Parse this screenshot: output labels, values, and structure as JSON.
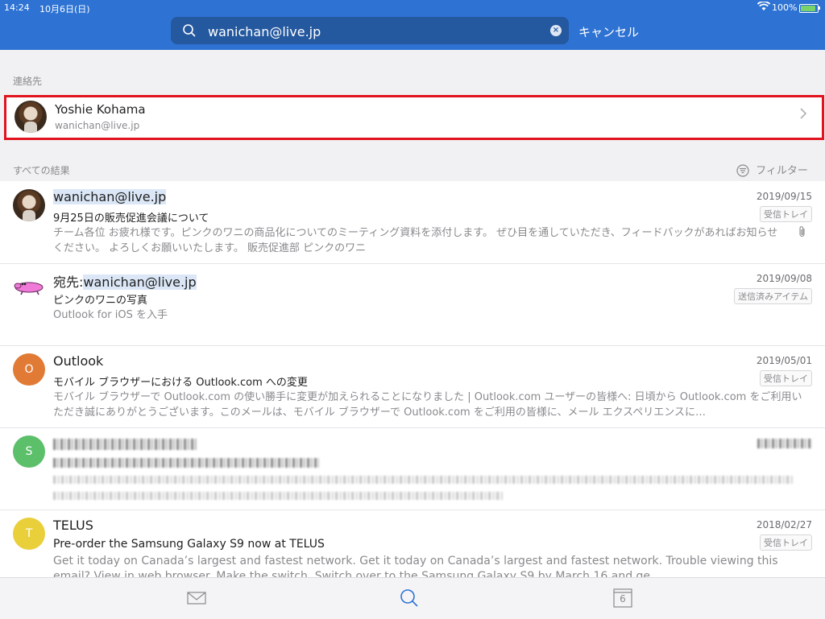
{
  "status_bar": {
    "time": "14:24",
    "date": "10月6日(日)",
    "battery": "100%"
  },
  "search": {
    "query": "wanichan@live.jp",
    "cancel_label": "キャンセル"
  },
  "contacts_section": {
    "label": "連絡先",
    "contact": {
      "name": "Yoshie Kohama",
      "email": "wanichan@live.jp"
    }
  },
  "results_section": {
    "label": "すべての結果",
    "filter_label": "フィルター"
  },
  "messages": [
    {
      "sender": "wanichan@live.jp",
      "subject": "9月25日の販売促進会議について",
      "preview": "チーム各位 お疲れ様です。ピンクのワニの商品化についてのミーティング資料を添付します。 ぜひ目を通していただき、フィードバックがあればお知らせください。 よろしくお願いいたします。 販売促進部 ピンクのワニ",
      "date": "2019/09/15",
      "folder": "受信トレイ",
      "has_attachment": true
    },
    {
      "sender_prefix": "宛先:",
      "sender": "wanichan@live.jp",
      "subject": "ピンクのワニの写真",
      "preview": "Outlook for iOS を入手",
      "date": "2019/09/08",
      "folder": "送信済みアイテム"
    },
    {
      "avatar_letter": "O",
      "avatar_color": "#e07a35",
      "sender": "Outlook",
      "subject": "モバイル ブラウザーにおける Outlook.com への変更",
      "preview": "モバイル ブラウザーで Outlook.com の使い勝手に変更が加えられることになりました | Outlook.com ユーザーの皆様へ: 日頃から Outlook.com をご利用いただき誠にありがとうございます。このメールは、モバイル ブラウザーで Outlook.com をご利用の皆様に、メール エクスペリエンスに…",
      "date": "2019/05/01",
      "folder": "受信トレイ"
    },
    {
      "avatar_letter": "S",
      "avatar_color": "#5cbf6a"
    },
    {
      "avatar_letter": "T",
      "avatar_color": "#e9cf3a",
      "sender": "TELUS",
      "subject": "Pre-order the Samsung Galaxy S9 now at TELUS",
      "preview": "Get it today on Canada’s largest and fastest network. Get it today on Canada’s largest and fastest network. Trouble viewing this email? View in web browser. Make the switch. Switch over to the Samsung Galaxy S9 by March 16 and ge…",
      "date": "2018/02/27",
      "folder": "受信トレイ"
    }
  ],
  "tab_bar": {
    "calendar_day": "6"
  },
  "colors": {
    "header": "#2e73d3",
    "search_field": "#24589f",
    "highlight_border": "#e0131e"
  }
}
